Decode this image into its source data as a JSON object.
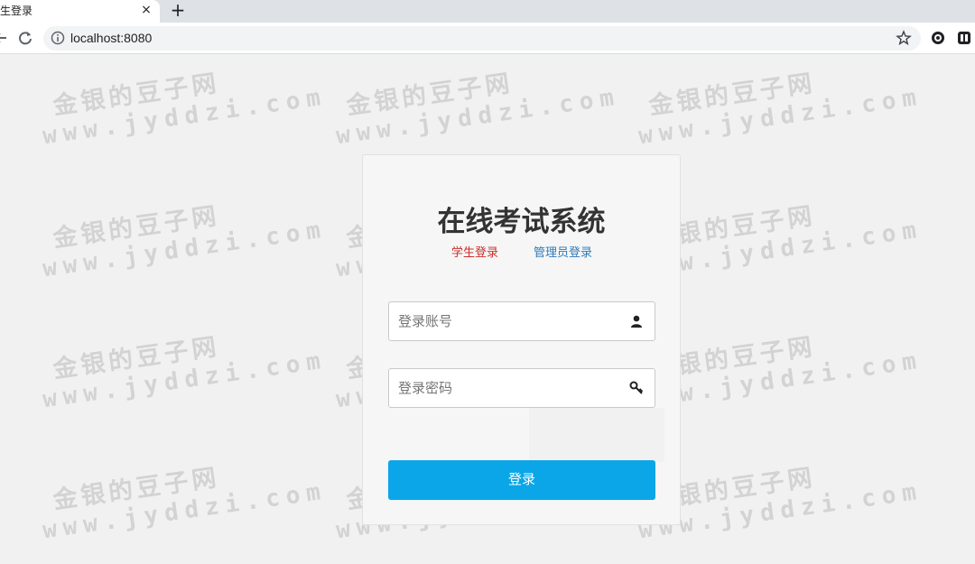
{
  "browser": {
    "tab_title": "生登录",
    "tab_close": "×",
    "new_tab": "+",
    "url": "localhost:8080"
  },
  "watermark": {
    "line1": "金银的豆子网",
    "line2": "www.jyddzi.com"
  },
  "login": {
    "title": "在线考试系统",
    "roles": {
      "student": "学生登录",
      "admin": "管理员登录"
    },
    "account_placeholder": "登录账号",
    "password_placeholder": "登录密码",
    "submit_label": "登录",
    "colors": {
      "student_role": "#c9302c",
      "admin_role": "#2e7bb8",
      "submit_button": "#0aa6e8"
    }
  },
  "icons": {
    "back": "back-arrow-icon",
    "reload": "reload-icon",
    "info": "info-icon",
    "bookmark": "star-icon",
    "extension1": "extension-icon",
    "extension2": "extension-icon",
    "account": "user-icon",
    "password": "key-icon"
  }
}
